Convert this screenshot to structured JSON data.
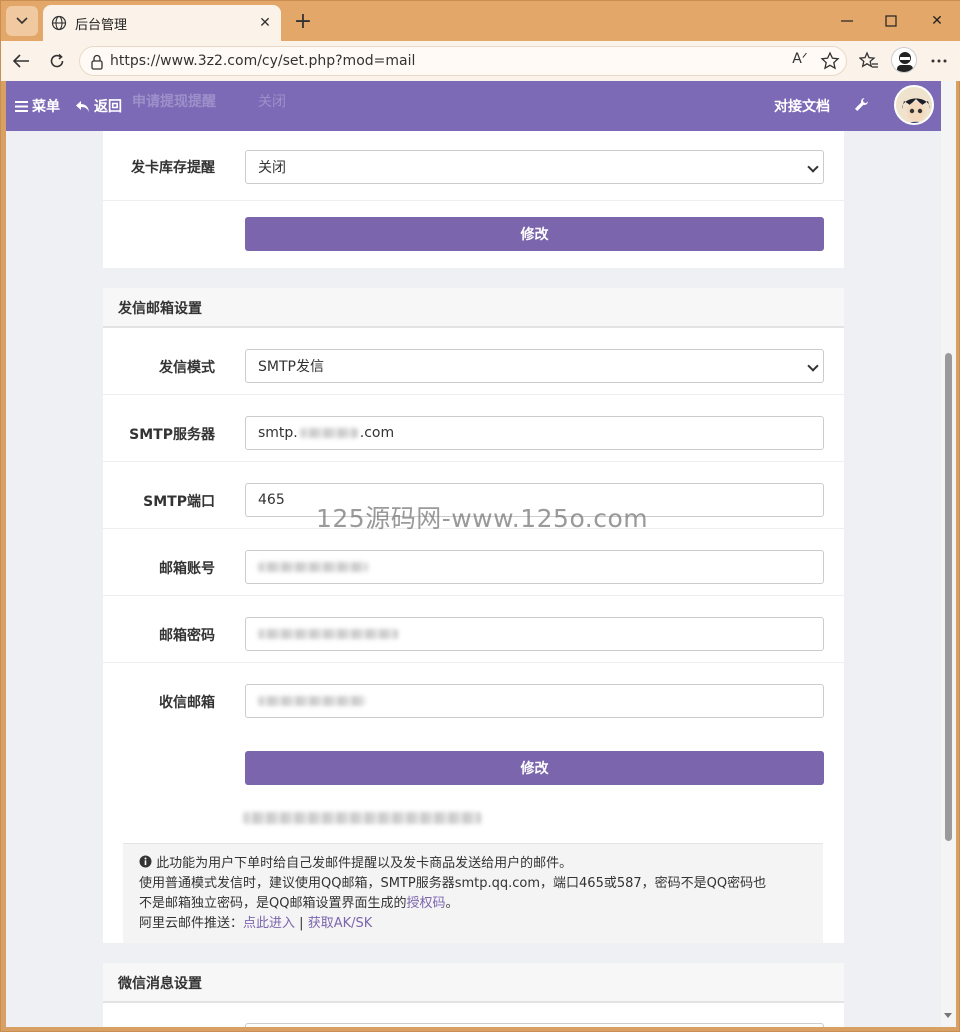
{
  "browser": {
    "tab_title": "后台管理",
    "url": "https://www.3z2.com/cy/set.php?mod=mail"
  },
  "appbar": {
    "menu_label": "菜单",
    "back_label": "返回",
    "docs_label": "对接文档",
    "hidden_label": "申请提现提醒",
    "hidden_value": "关闭"
  },
  "card_stock": {
    "label": "发卡库存提醒",
    "value": "关闭",
    "submit": "修改"
  },
  "mail_settings": {
    "heading": "发信邮箱设置",
    "mode_label": "发信模式",
    "mode_value": "SMTP发信",
    "server_label": "SMTP服务器",
    "server_prefix": "smtp.",
    "server_suffix": ".com",
    "port_label": "SMTP端口",
    "port_value": "465",
    "account_label": "邮箱账号",
    "password_label": "邮箱密码",
    "receiver_label": "收信邮箱",
    "submit": "修改"
  },
  "info": {
    "line1": "此功能为用户下单时给自己发邮件提醒以及发卡商品发送给用户的邮件。",
    "line2": "使用普通模式发信时，建议使用QQ邮箱，SMTP服务器smtp.qq.com，端口465或587，密码不是QQ密码也",
    "line3_a": "不是邮箱独立密码，是QQ邮箱设置界面生成的",
    "line3_link": "授权码",
    "line3_end": "。",
    "line4_prefix": "阿里云邮件推送：",
    "link_enter": "点此进入",
    "separator": "|",
    "link_aksk": "获取AK/SK"
  },
  "wechat": {
    "heading": "微信消息设置"
  },
  "watermark": "125源码网-www.125o.com"
}
